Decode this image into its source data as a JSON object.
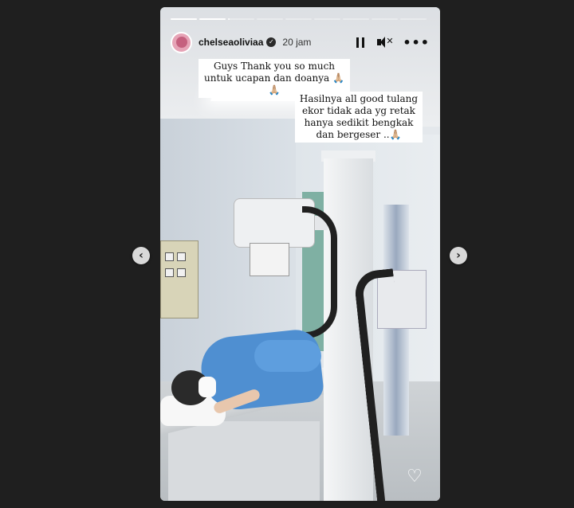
{
  "story": {
    "progress": {
      "total_segments": 9,
      "current_segment": 3,
      "current_fraction": 0.05
    },
    "header": {
      "username": "chelseaoliviaa",
      "verified": true,
      "time_ago": "20 jam"
    },
    "captions": [
      "Guys Thank you so much untuk ucapan dan doanya 🙏🏼🙏🏼",
      "Hasilnya all good tulang ekor tidak ada yg retak hanya sedikit bengkak dan bergeser ..🙏🏼"
    ],
    "icons": {
      "pause": "pause-icon",
      "mute": "mute-icon",
      "more": "more-icon",
      "like": "heart-icon",
      "prev": "chevron-left-icon",
      "next": "chevron-right-icon"
    }
  },
  "colors": {
    "background": "#1f1f1f",
    "gown": "#4f8fd1",
    "caption_bg": "#ffffff"
  }
}
